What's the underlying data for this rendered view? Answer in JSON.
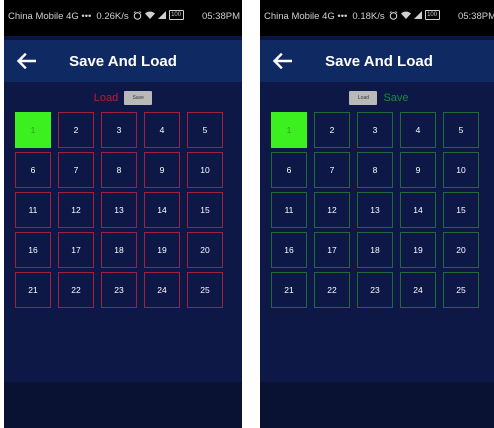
{
  "colors": {
    "status_bar": "#000000",
    "app_bar": "#0f2a63",
    "background": "#0d1846",
    "load_accent": "#c8143c",
    "save_accent": "#1c8a3a",
    "selected_slot": "#3cf020"
  },
  "screens": [
    {
      "status": {
        "carrier": "China Mobile 4G •••",
        "speed": "0.26K/s",
        "time": "05:38PM",
        "battery": "100"
      },
      "title": "Save And Load",
      "mode_label": "Load",
      "mode_button": "Save",
      "slots": [
        "1",
        "2",
        "3",
        "4",
        "5",
        "6",
        "7",
        "8",
        "9",
        "10",
        "11",
        "12",
        "13",
        "14",
        "15",
        "16",
        "17",
        "18",
        "19",
        "20",
        "21",
        "22",
        "23",
        "24",
        "25"
      ],
      "selected_slot": "1"
    },
    {
      "status": {
        "carrier": "China Mobile 4G •••",
        "speed": "0.18K/s",
        "time": "05:38PM",
        "battery": "100"
      },
      "title": "Save And Load",
      "mode_label": "Save",
      "mode_button": "Load",
      "slots": [
        "1",
        "2",
        "3",
        "4",
        "5",
        "6",
        "7",
        "8",
        "9",
        "10",
        "11",
        "12",
        "13",
        "14",
        "15",
        "16",
        "17",
        "18",
        "19",
        "20",
        "21",
        "22",
        "23",
        "24",
        "25"
      ],
      "selected_slot": "1"
    }
  ]
}
